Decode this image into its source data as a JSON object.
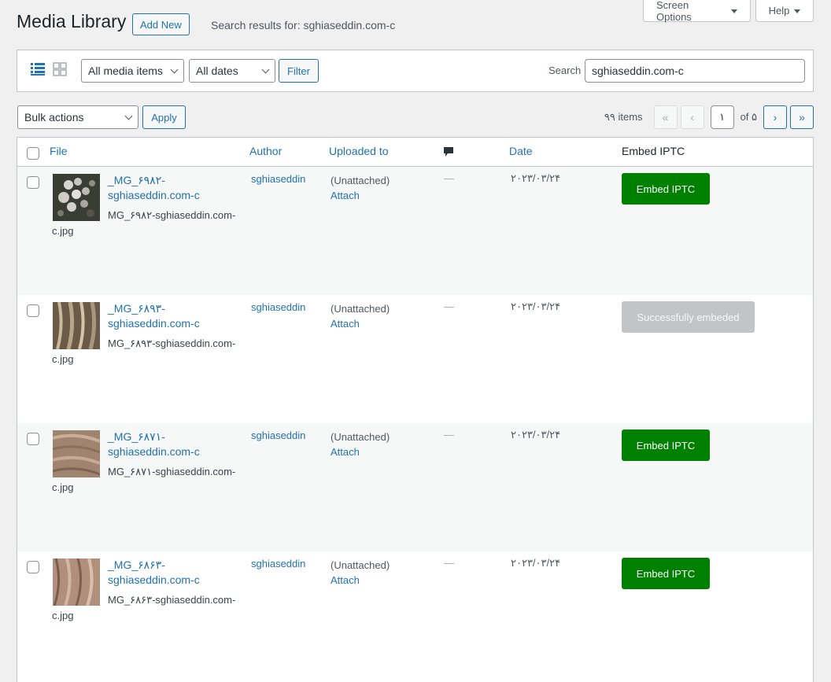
{
  "header": {
    "title": "Media Library",
    "add_new": "Add New",
    "subtitle": "Search results for: sghiaseddin.com-c",
    "screen_options": "Screen Options",
    "help": "Help"
  },
  "filters": {
    "media_type": "All media items",
    "dates": "All dates",
    "filter_button": "Filter",
    "search_label": "Search",
    "search_value": "sghiaseddin.com-c"
  },
  "bulk": {
    "action": "Bulk actions",
    "apply": "Apply"
  },
  "pagination": {
    "items": "۹۹ items",
    "first": "«",
    "prev": "‹",
    "current": "۱",
    "of": "of ۵",
    "next": "›",
    "last": "»"
  },
  "columns": {
    "file": "File",
    "author": "Author",
    "uploaded_to": "Uploaded to",
    "date": "Date",
    "embed": "Embed IPTC"
  },
  "rows": [
    {
      "title": "_MG_۶۹۸۲-sghiaseddin.com-c",
      "filename": "MG_۶۹۸۲-sghiaseddin.com-c.jpg",
      "author": "sghiaseddin",
      "uploaded": "(Unattached)",
      "attach": "Attach",
      "comments": "—",
      "date": "۲۰۲۳/۰۳/۲۴",
      "action": "Embed IPTC"
    },
    {
      "title": "_MG_۶۸۹۳-sghiaseddin.com-c",
      "filename": "MG_۶۸۹۳-sghiaseddin.com-c.jpg",
      "author": "sghiaseddin",
      "uploaded": "(Unattached)",
      "attach": "Attach",
      "comments": "—",
      "date": "۲۰۲۳/۰۳/۲۴",
      "action": "Successfully embeded"
    },
    {
      "title": "_MG_۶۸۷۱-sghiaseddin.com-c",
      "filename": "MG_۶۸۷۱-sghiaseddin.com-c.jpg",
      "author": "sghiaseddin",
      "uploaded": "(Unattached)",
      "attach": "Attach",
      "comments": "—",
      "date": "۲۰۲۳/۰۳/۲۴",
      "action": "Embed IPTC"
    },
    {
      "title": "_MG_۶۸۶۳-sghiaseddin.com-c",
      "filename": "MG_۶۸۶۳-sghiaseddin.com-c.jpg",
      "author": "sghiaseddin",
      "uploaded": "(Unattached)",
      "attach": "Attach",
      "comments": "—",
      "date": "۲۰۲۳/۰۳/۲۴",
      "action": "Embed IPTC"
    }
  ],
  "colors": {
    "link": "#2271b1",
    "embed_green": "#008000",
    "embedded_gray": "#c3c4c7"
  }
}
